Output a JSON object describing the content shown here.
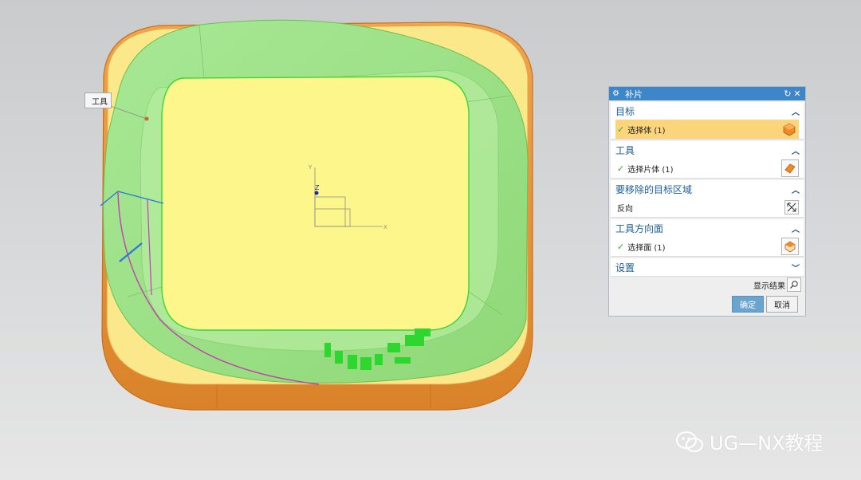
{
  "viewport": {
    "tool_tag": "工具",
    "axis_z": "Z",
    "axis_y": "Y",
    "axis_x": "X"
  },
  "dialog": {
    "title": "补片",
    "sections": [
      {
        "header": "目标",
        "row_label": "选择体 (1)",
        "checked": true,
        "selected": true,
        "icon": "solid-body-icon"
      },
      {
        "header": "工具",
        "row_label": "选择片体 (1)",
        "checked": true,
        "selected": false,
        "icon": "sheet-body-icon"
      },
      {
        "header": "要移除的目标区域",
        "row_label": "反向",
        "checked": false,
        "selected": false,
        "icon": "reverse-direction-icon"
      },
      {
        "header": "工具方向面",
        "row_label": "选择面 (1)",
        "checked": true,
        "selected": false,
        "icon": "select-face-icon"
      },
      {
        "header": "设置",
        "collapsed": true
      }
    ],
    "show_result": "显示结果",
    "ok": "确定",
    "cancel": "取消"
  },
  "watermark": {
    "text": "UG—NX教程"
  },
  "colors": {
    "title_bar": "#3d86c8",
    "selected_row": "#fbd57c",
    "model_orange": "#e8953a",
    "model_green": "#9be085",
    "model_yellow": "#fdf68a"
  }
}
